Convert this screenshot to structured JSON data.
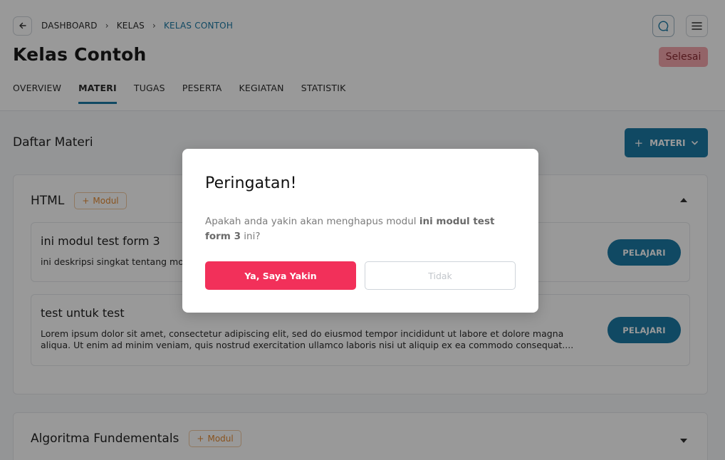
{
  "breadcrumb": {
    "items": [
      "DASHBOARD",
      "KELAS",
      "KELAS CONTOH"
    ]
  },
  "header": {
    "title": "Kelas Contoh",
    "status": "Selesai"
  },
  "tabs": [
    {
      "label": "OVERVIEW",
      "active": false
    },
    {
      "label": "MATERI",
      "active": true
    },
    {
      "label": "TUGAS",
      "active": false
    },
    {
      "label": "PESERTA",
      "active": false
    },
    {
      "label": "KEGIATAN",
      "active": false
    },
    {
      "label": "STATISTIK",
      "active": false
    }
  ],
  "section": {
    "title": "Daftar Materi",
    "add_button": "MATERI"
  },
  "modules": [
    {
      "name": "HTML",
      "chip": "Modul",
      "expanded": true,
      "items": [
        {
          "title": "ini modul test form 3",
          "description": "ini deskripsi singkat tentang modul",
          "button": "PELAJARI"
        },
        {
          "title": "test untuk test",
          "description": "Lorem ipsum dolor sit amet, consectetur adipiscing elit, sed do eiusmod tempor incididunt ut labore et dolore magna aliqua. Ut enim ad minim veniam, quis nostrud exercitation ullamco laboris nisi ut aliquip ex ea commodo consequat....",
          "button": "PELAJARI"
        }
      ]
    },
    {
      "name": "Algoritma Fundementals",
      "chip": "Modul",
      "expanded": false
    }
  ],
  "modal": {
    "title": "Peringatan!",
    "message_prefix": "Apakah anda yakin akan menghapus modul ",
    "message_bold": "ini modul test form 3",
    "message_suffix": " ini?",
    "confirm": "Ya, Saya Yakin",
    "cancel": "Tidak"
  },
  "colors": {
    "primary": "#1c7aa6",
    "danger": "#f2305a",
    "status_badge": "#f6a7ad",
    "chip": "#e48a32"
  },
  "icons": [
    "arrow-left-icon",
    "chat-icon",
    "menu-icon",
    "plus-icon",
    "chevron-down-icon",
    "chevron-up-icon"
  ]
}
